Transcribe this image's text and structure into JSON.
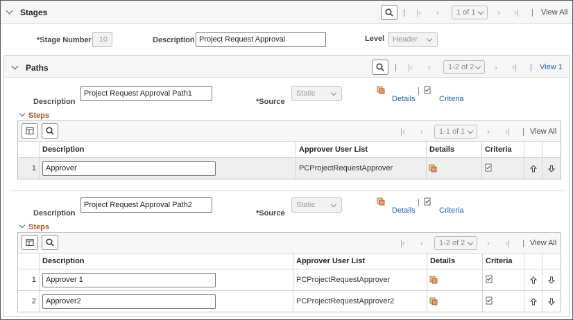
{
  "stages": {
    "title": "Stages",
    "pager": "1 of 1",
    "view_all": "View All",
    "stage_number_label": "Stage Number",
    "stage_number_value": "10",
    "description_label": "Description",
    "description_value": "Project Request Approval",
    "level_label": "Level",
    "level_value": "Header"
  },
  "paths": {
    "title": "Paths",
    "pager": "1-2 of 2",
    "view_link": "View 1",
    "items": [
      {
        "description_label": "Description",
        "description_value": "Project Request Approval Path1",
        "source_label": "Source",
        "source_value": "Static",
        "details_link": "Details",
        "criteria_link": "Criteria",
        "steps": {
          "title": "Steps",
          "pager": "1-1 of 1",
          "view_all": "View All",
          "columns": [
            "Description",
            "Approver User List",
            "Details",
            "Criteria"
          ],
          "rows": [
            {
              "num": "1",
              "description": "Approver",
              "approver_list": "PCProjectRequestApprover"
            }
          ]
        }
      },
      {
        "description_label": "Description",
        "description_value": "Project Request Approval Path2",
        "source_label": "Source",
        "source_value": "Static",
        "details_link": "Details",
        "criteria_link": "Criteria",
        "steps": {
          "title": "Steps",
          "pager": "1-2 of 2",
          "view_all": "View All",
          "columns": [
            "Description",
            "Approver User List",
            "Details",
            "Criteria"
          ],
          "rows": [
            {
              "num": "1",
              "description": "Approver 1",
              "approver_list": "PCProjectRequestApprover"
            },
            {
              "num": "2",
              "description": "Approver2",
              "approver_list": "PCProjectRequestApprover2"
            }
          ]
        }
      }
    ]
  },
  "required_marker": "*",
  "icons": {
    "search": "search-icon",
    "first": "first-page-icon",
    "prev": "previous-icon",
    "next": "next-icon",
    "last": "last-page-icon",
    "details": "details-icon",
    "criteria": "criteria-icon",
    "move_up": "move-up-icon",
    "move_down": "move-down-icon",
    "personalize": "grid-personalize-icon"
  },
  "colors": {
    "steps_title": "#a5542b",
    "link_blue": "#1f5fa8"
  }
}
